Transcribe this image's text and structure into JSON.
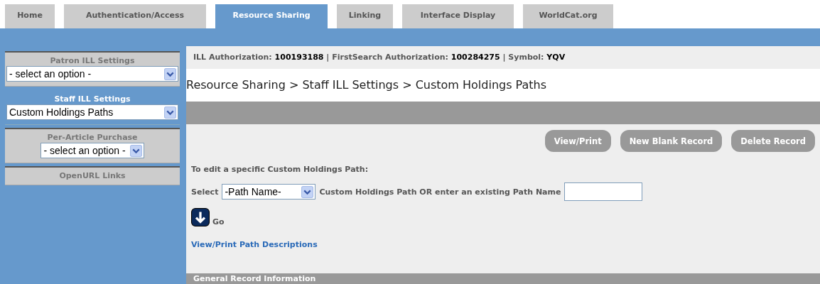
{
  "tabs": [
    {
      "label": "Home",
      "selected": false
    },
    {
      "label": "Authentication/Access",
      "selected": false
    },
    {
      "label": "Resource Sharing",
      "selected": true
    },
    {
      "label": "Linking",
      "selected": false
    },
    {
      "label": "Interface Display",
      "selected": false
    },
    {
      "label": "WorldCat.org",
      "selected": false
    }
  ],
  "sidebar": {
    "sections": [
      {
        "title": "Patron ILL Settings",
        "selected": false,
        "select": "- select an option -",
        "wide": true
      },
      {
        "title": "Staff ILL Settings",
        "selected": true,
        "select": "Custom Holdings Paths",
        "wide": true
      },
      {
        "title": "Per-Article Purchase",
        "selected": false,
        "select": "- select an option -",
        "wide": false
      },
      {
        "title": "OpenURL Links",
        "selected": false
      }
    ]
  },
  "info_bar": "ILL Authorization: **100193188** | FirstSearch Authorization: **100284275** | Symbol: **YQV**",
  "breadcrumb": "Resource Sharing > Staff ILL Settings > Custom Holdings Paths",
  "buttons": [
    "View/Print",
    "New Blank Record",
    "Delete Record"
  ],
  "instruction": "To edit a specific Custom Holdings Path:",
  "select_row": {
    "before": "Select",
    "select": "-Path Name-",
    "after": "Custom Holdings Path OR enter an existing Path Name"
  },
  "go_label": "Go",
  "link": "View/Print Path Descriptions",
  "section_bar": "General Record Information"
}
